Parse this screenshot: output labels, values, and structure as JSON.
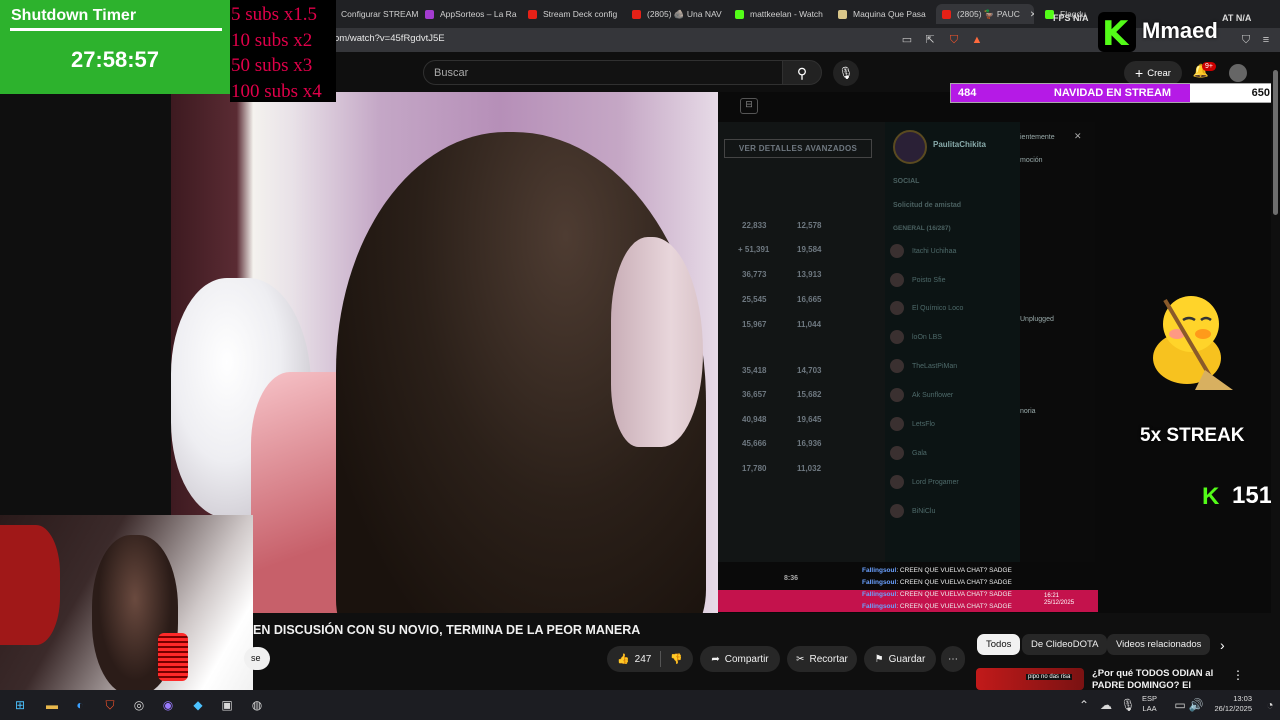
{
  "browser": {
    "tabs": [
      {
        "label": "Configurar STREAM",
        "color": "#7a7a7a"
      },
      {
        "label": "AppSorteos – La Ra",
        "color": "#a43cd0"
      },
      {
        "label": "Stream Deck config",
        "color": "#e62117"
      },
      {
        "label": "(2805) 🪨 Una NAV",
        "color": "#e62117"
      },
      {
        "label": "mattkeelan - Watch",
        "color": "#53fc18"
      },
      {
        "label": "Maquina Que Pasa",
        "color": "#d9c68a"
      },
      {
        "label": "(2805) 🦆 PAUC",
        "color": "#e62117"
      },
      {
        "label": "Flagdu",
        "color": "#53fc18"
      }
    ],
    "url": "om/watch?v=45fRgdvtJ5E"
  },
  "youtube": {
    "search_placeholder": "Buscar",
    "create_label": "Crear",
    "notifications_badge": "9+",
    "video_title": "EN DISCUSIÓN CON SU NOVIO, TERMINA DE LA PEOR MANERA",
    "subscribe_label": "se",
    "like_count": "247",
    "share_label": "Compartir",
    "clip_label": "Recortar",
    "save_label": "Guardar",
    "chips": [
      "Todos",
      "De ClideoDOTA",
      "Videos relacionados"
    ],
    "recommended": {
      "title": "¿Por qué TODOS ODIAN al PADRE DOMINGO? El Streamer",
      "thumb_text": "pipo no das risa"
    }
  },
  "overlay": {
    "timer_title": "Shutdown Timer",
    "timer_value": "27:58:57",
    "subs_multipliers": [
      "5 subs x1.5",
      "10 subs x2",
      "50 subs x3",
      "100 subs x4"
    ],
    "goal": {
      "current": "484",
      "title": "NAVIDAD EN STREAM",
      "target": "650",
      "progress": 0.745
    },
    "kick_name": "Mmaed",
    "streak": "5x STREAK",
    "kick_count": "151",
    "fps_label": "FPS",
    "fps_value": "N/A",
    "fps_right": "AT  N/A"
  },
  "game": {
    "details_button": "VER DETALLES AVANZADOS",
    "stats": [
      [
        "22,833",
        "12,578"
      ],
      [
        "+ 51,391",
        "19,584"
      ],
      [
        "36,773",
        "13,913"
      ],
      [
        "25,545",
        "16,665"
      ],
      [
        "15,967",
        "11,044"
      ],
      [
        "35,418",
        "14,703"
      ],
      [
        "36,657",
        "15,682"
      ],
      [
        "40,948",
        "19,645"
      ],
      [
        "45,666",
        "16,936"
      ],
      [
        "17,780",
        "11,032"
      ]
    ],
    "time": "8:36",
    "profile_name": "PaulitaChikita",
    "social_label": "SOCIAL",
    "friend_request": "Solicitud de amistad",
    "general_label": "GENERAL (16/287)",
    "friends": [
      "Itachi Uchihaa",
      "Poisto Sfie",
      "El Químico Loco",
      "loOn LBS",
      "TheLastPiMan",
      "Ak Sunflower",
      "LetsFlo",
      "Gala",
      "Lord Progamer",
      "BiNiClu"
    ],
    "side_texts": [
      "Unplugged",
      "noria",
      "ientemente",
      "moción"
    ],
    "chat_lines": [
      {
        "user": "Fallingsoul",
        "msg": ": CREEN QUE VUELVA CHAT? SADGE"
      },
      {
        "user": "Fallingsoul",
        "msg": ": CREEN QUE VUELVA CHAT? SADGE"
      },
      {
        "user": "Fallingsoul",
        "msg": ": CREEN QUE VUELVA CHAT? SADGE"
      },
      {
        "user": "Fallingsoul",
        "msg": ": CREEN QUE VUELVA CHAT? SADGE"
      }
    ],
    "game_clock": "16:21\n25/12/2025"
  },
  "taskbar": {
    "lang": "ESP\nLAA",
    "time": "13:03",
    "date": "26/12/2025"
  }
}
